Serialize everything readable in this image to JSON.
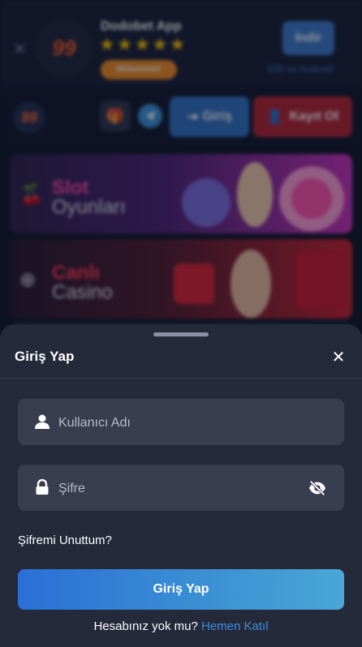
{
  "app_banner": {
    "logo_text": "99",
    "app_name": "Dodobet App",
    "stars": "★★★★★",
    "badge": "Mükemmel!",
    "install_label": "İndir",
    "platform_text": "iOS ve Android"
  },
  "header": {
    "logo_text": "99",
    "login_label": "Giriş",
    "register_label": "Kayıt Ol"
  },
  "promos": [
    {
      "word1": "Slot",
      "word2": "Oyunları"
    },
    {
      "word1": "Canlı",
      "word2": "Casino"
    }
  ],
  "login_sheet": {
    "title": "Giriş Yap",
    "username_placeholder": "Kullanıcı Adı",
    "password_placeholder": "Şifre",
    "forgot_label": "Şifremi Unuttum?",
    "submit_label": "Giriş Yap",
    "no_account_text": "Hesabınız yok mu?",
    "join_link": "Hemen Katıl"
  },
  "colors": {
    "sheet_bg": "#252a3a",
    "field_bg": "#383d4f",
    "accent_blue": "#3d8ee0",
    "register_red": "#b3202e"
  }
}
